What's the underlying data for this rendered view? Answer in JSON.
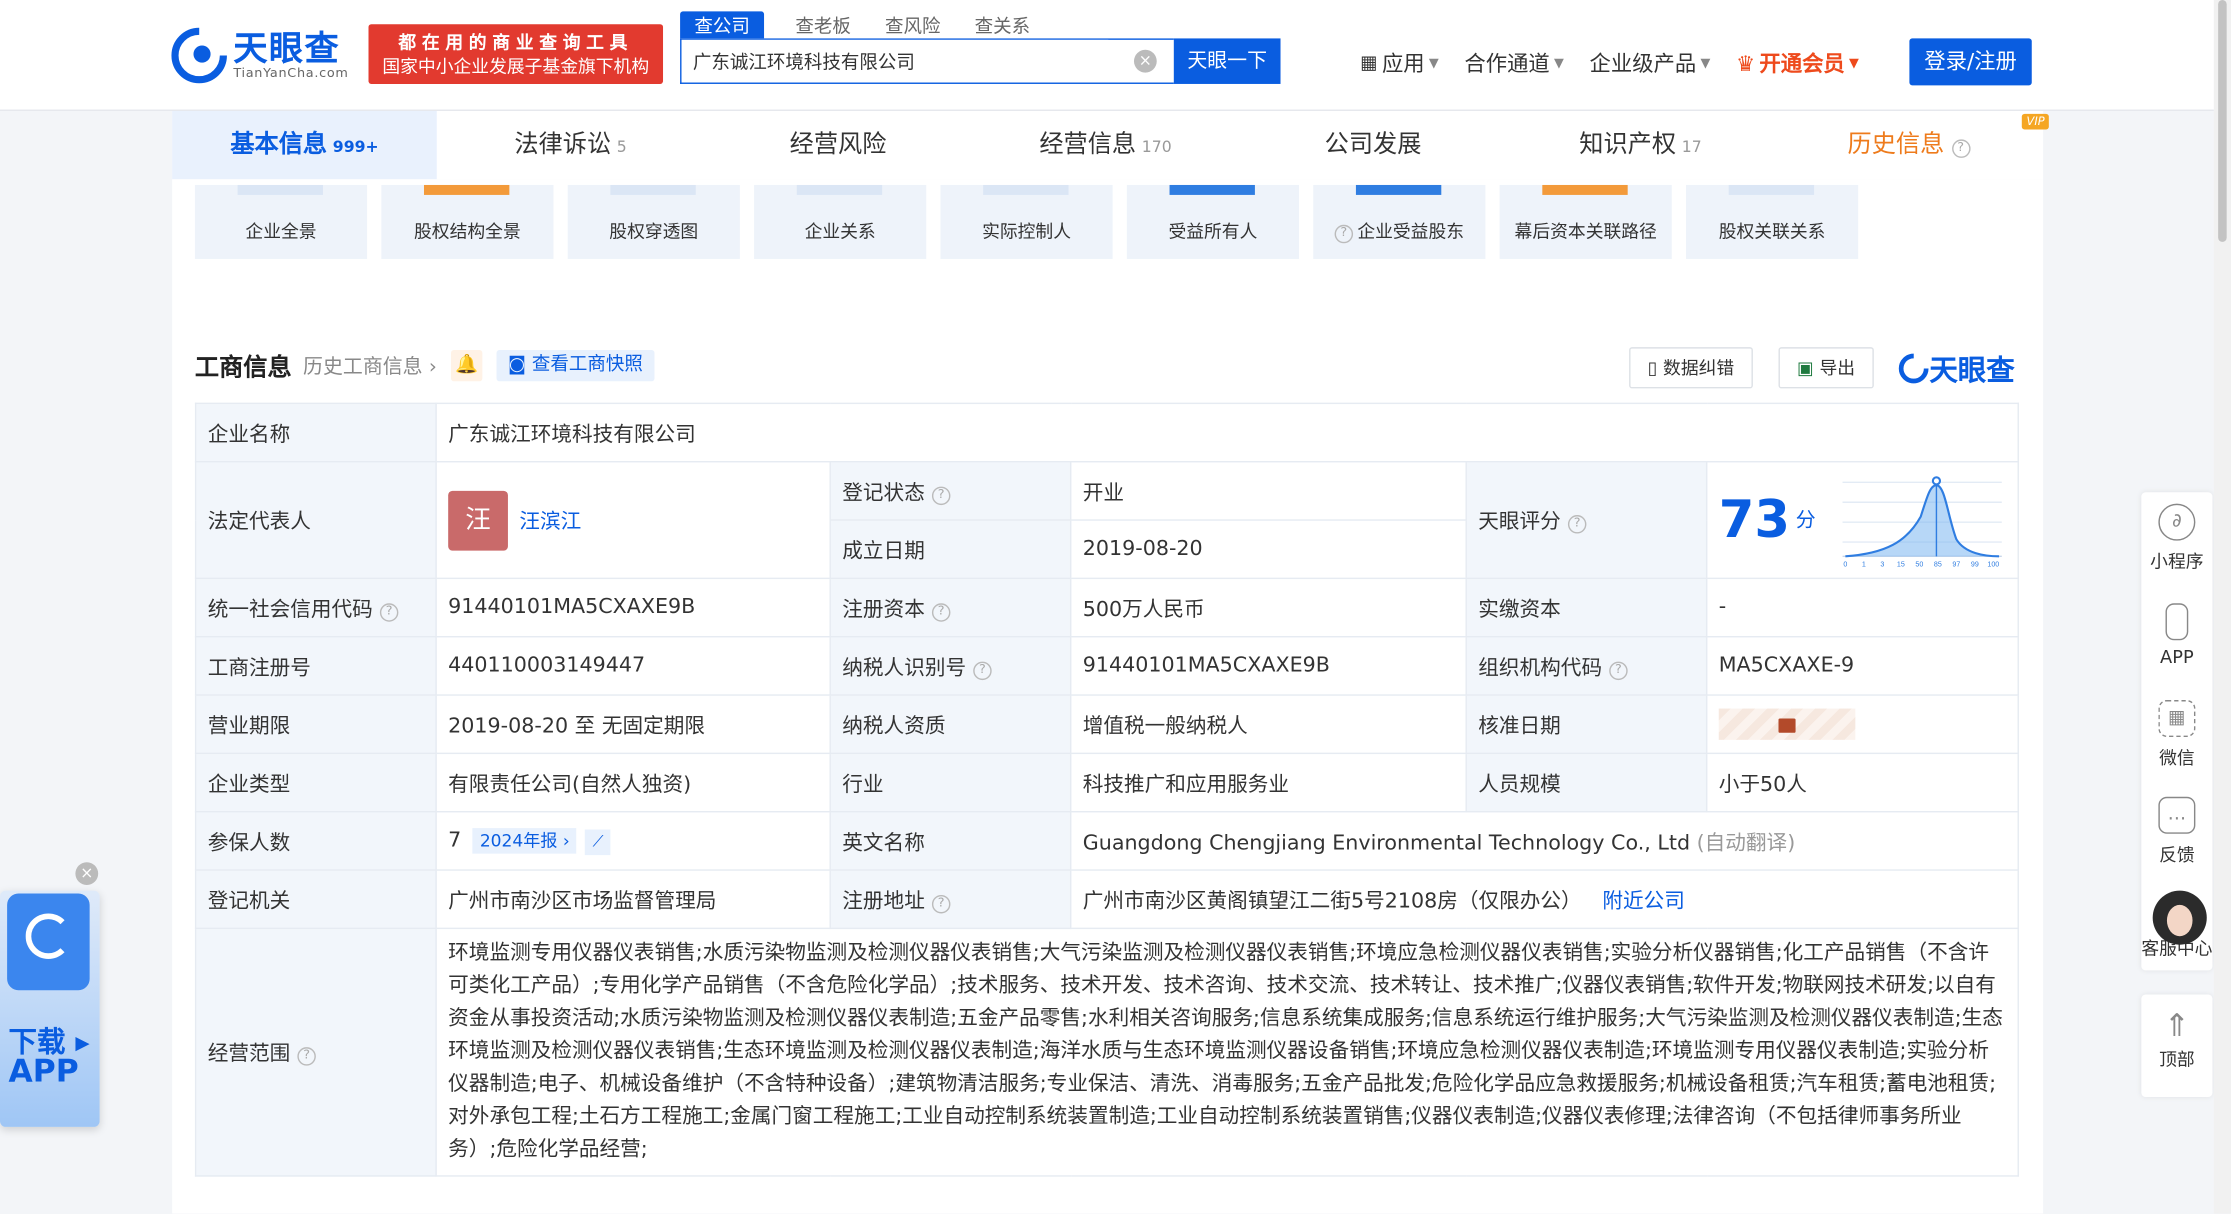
{
  "header": {
    "logo_cn": "天眼查",
    "logo_en": "TianYanCha.com",
    "slogan1": "都在用的商业查询工具",
    "slogan2": "国家中小企业发展子基金旗下机构",
    "search_tabs": [
      "查公司",
      "查老板",
      "查风险",
      "查关系"
    ],
    "search_value": "广东诚江环境科技有限公司",
    "search_button": "天眼一下",
    "nav": [
      "应用",
      "合作通道",
      "企业级产品",
      "开通会员"
    ],
    "login": "登录/注册"
  },
  "tabs": [
    {
      "label": "基本信息",
      "count": "999+"
    },
    {
      "label": "法律诉讼",
      "count": "5"
    },
    {
      "label": "经营风险",
      "count": ""
    },
    {
      "label": "经营信息",
      "count": "170"
    },
    {
      "label": "公司发展",
      "count": ""
    },
    {
      "label": "知识产权",
      "count": "17"
    },
    {
      "label": "历史信息",
      "count": ""
    }
  ],
  "tiles": [
    "企业全景",
    "股权结构全景",
    "股权穿透图",
    "企业关系",
    "实际控制人",
    "受益所有人",
    "企业受益股东",
    "幕后资本关联路径",
    "股权关联关系"
  ],
  "section": {
    "title": "工商信息",
    "history": "历史工商信息",
    "snapshot": "查看工商快照",
    "correct": "数据纠错",
    "export": "导出",
    "brand": "天眼查"
  },
  "info": {
    "company_name_k": "企业名称",
    "company_name": "广东诚江环境科技有限公司",
    "legal_k": "法定代表人",
    "legal_avatar": "汪",
    "legal_name": "汪滨江",
    "status_k": "登记状态",
    "status": "开业",
    "score_k": "天眼评分",
    "score": "73",
    "score_unit": "分",
    "found_k": "成立日期",
    "found": "2019-08-20",
    "credit_k": "统一社会信用代码",
    "credit": "91440101MA5CXAXE9B",
    "capital_k": "注册资本",
    "capital": "500万人民币",
    "paid_k": "实缴资本",
    "paid": "-",
    "reg_k": "工商注册号",
    "reg": "440110003149447",
    "taxid_k": "纳税人识别号",
    "taxid": "91440101MA5CXAXE9B",
    "org_k": "组织机构代码",
    "org": "MA5CXAXE-9",
    "term_k": "营业期限",
    "term": "2019-08-20 至 无固定期限",
    "taxq_k": "纳税人资质",
    "taxq": "增值税一般纳税人",
    "approve_k": "核准日期",
    "type_k": "企业类型",
    "type": "有限责任公司(自然人独资)",
    "industry_k": "行业",
    "industry": "科技推广和应用服务业",
    "staff_k": "人员规模",
    "staff": "小于50人",
    "insured_k": "参保人数",
    "insured": "7",
    "report": "2024年报",
    "en_k": "英文名称",
    "en": "Guangdong Chengjiang Environmental Technology Co., Ltd",
    "en_note": "(自动翻译)",
    "authority_k": "登记机关",
    "authority": "广州市南沙区市场监督管理局",
    "addr_k": "注册地址",
    "addr": "广州市南沙区黄阁镇望江二街5号2108房（仅限办公）",
    "nearby": "附近公司",
    "scope_k": "经营范围",
    "scope": "环境监测专用仪器仪表销售;水质污染物监测及检测仪器仪表销售;大气污染监测及检测仪器仪表销售;环境应急检测仪器仪表销售;实验分析仪器销售;化工产品销售（不含许可类化工产品）;专用化学产品销售（不含危险化学品）;技术服务、技术开发、技术咨询、技术交流、技术转让、技术推广;仪器仪表销售;软件开发;物联网技术研发;以自有资金从事投资活动;水质污染物监测及检测仪器仪表制造;五金产品零售;水利相关咨询服务;信息系统集成服务;信息系统运行维护服务;大气污染监测及检测仪器仪表制造;生态环境监测及检测仪器仪表销售;生态环境监测及检测仪器仪表制造;海洋水质与生态环境监测仪器设备销售;环境应急检测仪器仪表制造;环境监测专用仪器仪表制造;实验分析仪器制造;电子、机械设备维护（不含特种设备）;建筑物清洁服务;专业保洁、清洗、消毒服务;五金产品批发;危险化学品应急救援服务;机械设备租赁;汽车租赁;蓄电池租赁;对外承包工程;土石方工程施工;金属门窗工程施工;工业自动控制系统装置制造;工业自动控制系统装置销售;仪器仪表制造;仪器仪表修理;法律咨询（不包括律师事务所业务）;危险化学品经营;"
  },
  "score_axis": [
    "0",
    "1",
    "3",
    "15",
    "50",
    "85",
    "97",
    "99",
    "100"
  ],
  "sidebar": [
    "小程序",
    "APP",
    "微信",
    "反馈",
    "客服中心",
    "顶部"
  ],
  "download": {
    "line1": "下载",
    "line2": "APP"
  }
}
